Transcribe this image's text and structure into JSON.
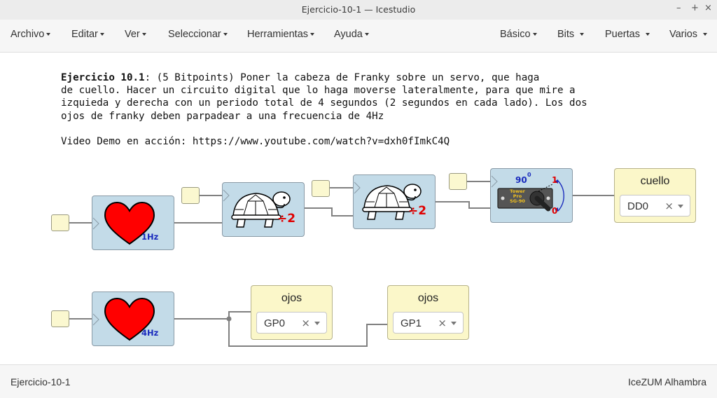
{
  "window": {
    "title": "Ejercicio-10-1 — Icestudio"
  },
  "menu": {
    "left": [
      "Archivo",
      "Editar",
      "Ver",
      "Seleccionar",
      "Herramientas",
      "Ayuda"
    ],
    "right": [
      "Básico",
      "Bits",
      "Puertas",
      "Varios"
    ]
  },
  "description": {
    "heading": "Ejercicio 10.1",
    "line1": ": (5 Bitpoints) Poner la cabeza de Franky sobre un servo, que haga",
    "line2": "de cuello. Hacer un circuito digital que lo haga moverse lateralmente, para que mire a",
    "line3": "izquieda y derecha con un periodo total de 4 segundos (2 segundos en cada lado). Los dos",
    "line4": "ojos de franky deben parpadear a una frecuencia de 4Hz",
    "video": "Video Demo en acción: https://www.youtube.com/watch?v=dxh0fImkC4Q"
  },
  "blocks": {
    "heart_top_freq": "1Hz",
    "heart_bottom_freq": "4Hz",
    "divider_label": "÷2",
    "servo": {
      "angle": "90",
      "degree": "0",
      "brand_line1": "Tower",
      "brand_line2": "Pro",
      "brand_line3": "SG-90",
      "pos1": "1",
      "pos0": "0"
    }
  },
  "outputs": {
    "cuello": {
      "label": "cuello",
      "value": "DD0"
    },
    "ojos1": {
      "label": "ojos",
      "value": "GP0"
    },
    "ojos2": {
      "label": "ojos",
      "value": "GP1"
    },
    "clear": "×"
  },
  "status": {
    "left": "Ejercicio-10-1",
    "right": "IceZUM Alhambra"
  },
  "colors": {
    "block": "#c3dbe8",
    "io": "#fbf7c9",
    "heart": "#ff0000",
    "freq": "#1a2bbd",
    "divider": "#e00000"
  }
}
